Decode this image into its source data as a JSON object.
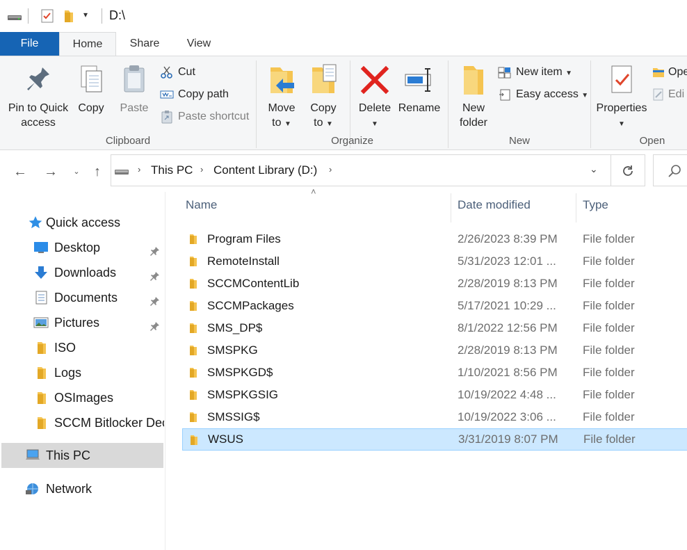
{
  "window": {
    "title": "D:\\"
  },
  "tabs": [
    {
      "label": "File"
    },
    {
      "label": "Home"
    },
    {
      "label": "Share"
    },
    {
      "label": "View"
    }
  ],
  "ribbon": {
    "clipboard": {
      "label": "Clipboard",
      "pin_label_1": "Pin to Quick",
      "pin_label_2": "access",
      "copy": "Copy",
      "paste": "Paste",
      "cut": "Cut",
      "copy_path": "Copy path",
      "paste_shortcut": "Paste shortcut"
    },
    "organize": {
      "label": "Organize",
      "move_1": "Move",
      "move_2": "to",
      "copy_1": "Copy",
      "copy_2": "to",
      "delete": "Delete",
      "rename": "Rename"
    },
    "new": {
      "label": "New",
      "new_folder_1": "New",
      "new_folder_2": "folder",
      "new_item": "New item",
      "easy_access": "Easy access"
    },
    "open": {
      "label": "Open",
      "properties": "Properties",
      "open": "Ope",
      "edit": "Edi"
    }
  },
  "address": {
    "crumbs": [
      "This PC",
      "Content Library (D:)"
    ]
  },
  "navpane": {
    "quick_access": "Quick access",
    "items": [
      {
        "label": "Desktop",
        "pinned": true,
        "icon": "desktop-icon"
      },
      {
        "label": "Downloads",
        "pinned": true,
        "icon": "downloads-icon"
      },
      {
        "label": "Documents",
        "pinned": true,
        "icon": "documents-icon"
      },
      {
        "label": "Pictures",
        "pinned": true,
        "icon": "pictures-icon"
      },
      {
        "label": "ISO",
        "pinned": false,
        "icon": "folder-icon"
      },
      {
        "label": "Logs",
        "pinned": false,
        "icon": "folder-icon"
      },
      {
        "label": "OSImages",
        "pinned": false,
        "icon": "folder-icon"
      },
      {
        "label": "SCCM Bitlocker Decr",
        "pinned": false,
        "icon": "folder-icon"
      }
    ],
    "this_pc": "This PC",
    "network": "Network"
  },
  "columns": {
    "name": "Name",
    "date": "Date modified",
    "type": "Type"
  },
  "files": [
    {
      "name": "Program Files",
      "date": "2/26/2023 8:39 PM",
      "type": "File folder"
    },
    {
      "name": "RemoteInstall",
      "date": "5/31/2023 12:01 ...",
      "type": "File folder"
    },
    {
      "name": "SCCMContentLib",
      "date": "2/28/2019 8:13 PM",
      "type": "File folder"
    },
    {
      "name": "SCCMPackages",
      "date": "5/17/2021 10:29 ...",
      "type": "File folder"
    },
    {
      "name": "SMS_DP$",
      "date": "8/1/2022 12:56 PM",
      "type": "File folder"
    },
    {
      "name": "SMSPKG",
      "date": "2/28/2019 8:13 PM",
      "type": "File folder"
    },
    {
      "name": "SMSPKGD$",
      "date": "1/10/2021 8:56 PM",
      "type": "File folder"
    },
    {
      "name": "SMSPKGSIG",
      "date": "10/19/2022 4:48 ...",
      "type": "File folder"
    },
    {
      "name": "SMSSIG$",
      "date": "10/19/2022 3:06 ...",
      "type": "File folder"
    },
    {
      "name": "WSUS",
      "date": "3/31/2019 8:07 PM",
      "type": "File folder",
      "selected": true
    }
  ],
  "colors": {
    "accent": "#1664b4",
    "selection": "#cce8ff",
    "folder": "#f5c451"
  }
}
